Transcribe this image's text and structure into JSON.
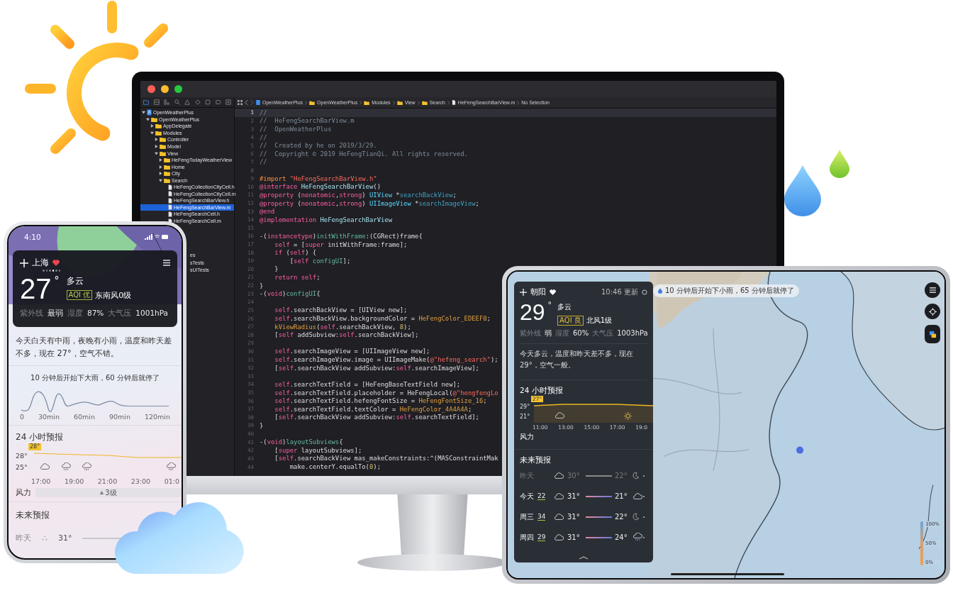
{
  "xcode": {
    "navigator_tabs": [
      {
        "kind": "folder",
        "selected": true
      },
      {
        "kind": "source",
        "selected": false
      },
      {
        "kind": "symbols",
        "selected": false
      },
      {
        "kind": "search",
        "selected": false
      },
      {
        "kind": "warning",
        "selected": false
      },
      {
        "kind": "test",
        "selected": false
      },
      {
        "kind": "debug",
        "selected": false
      },
      {
        "kind": "breakpoint",
        "selected": false
      },
      {
        "kind": "report",
        "selected": false
      }
    ],
    "tree": [
      {
        "label": "OpenWeatherPlus",
        "kind": "project",
        "expanded": true,
        "selected": false,
        "children": [
          {
            "label": "OpenWeatherPlus",
            "kind": "folder",
            "expanded": true,
            "selected": false,
            "children": [
              {
                "label": "AppDelegate",
                "kind": "folder",
                "expanded": false,
                "selected": false
              },
              {
                "label": "Modules",
                "kind": "folder",
                "expanded": true,
                "selected": false,
                "children": [
                  {
                    "label": "Controller",
                    "kind": "folder",
                    "expanded": false,
                    "selected": false
                  },
                  {
                    "label": "Model",
                    "kind": "folder",
                    "expanded": false,
                    "selected": false
                  },
                  {
                    "label": "View",
                    "kind": "folder",
                    "expanded": true,
                    "selected": false,
                    "children": [
                      {
                        "label": "HeFengTodayWeatherView",
                        "kind": "folder",
                        "expanded": false,
                        "selected": false
                      },
                      {
                        "label": "Home",
                        "kind": "folder",
                        "expanded": false,
                        "selected": false
                      },
                      {
                        "label": "City",
                        "kind": "folder",
                        "expanded": false,
                        "selected": false
                      },
                      {
                        "label": "Search",
                        "kind": "folder",
                        "expanded": true,
                        "selected": false,
                        "children": [
                          {
                            "label": "HeFengCollectionCityCell.h",
                            "kind": "file",
                            "selected": false
                          },
                          {
                            "label": "HeFengCollectionCityCell.m",
                            "kind": "file",
                            "selected": false
                          },
                          {
                            "label": "HeFengSearchBarView.h",
                            "kind": "file",
                            "selected": false
                          },
                          {
                            "label": "HeFengSearchBarView.m",
                            "kind": "file",
                            "selected": true
                          },
                          {
                            "label": "HeFengSearchCell.h",
                            "kind": "file",
                            "selected": false
                          },
                          {
                            "label": "HeFengSearchCell.m",
                            "kind": "file",
                            "selected": false
                          }
                        ]
                      }
                    ]
                  }
                ]
              }
            ]
          }
        ]
      }
    ],
    "tree_overflow": [
      "es",
      "sTests",
      "sUITests"
    ],
    "jump_bar": [
      {
        "kind": "project",
        "label": "OpenWeatherPlus"
      },
      {
        "kind": "folder",
        "label": "OpenWeatherPlus"
      },
      {
        "kind": "folder",
        "label": "Modules"
      },
      {
        "kind": "folder",
        "label": "View"
      },
      {
        "kind": "folder",
        "label": "Search"
      },
      {
        "kind": "file",
        "label": "HeFengSearchBarView.m"
      },
      {
        "kind": "none",
        "label": "No Selection"
      }
    ],
    "lines": [
      {
        "number": "1",
        "current": true,
        "tokens": [
          {
            "kind": "comment",
            "text": "//"
          }
        ]
      },
      {
        "number": "2",
        "current": false,
        "tokens": [
          {
            "kind": "comment",
            "text": "//  HeFengSearchBarView.m"
          }
        ]
      },
      {
        "number": "3",
        "current": false,
        "tokens": [
          {
            "kind": "comment",
            "text": "//  OpenWeatherPlus"
          }
        ]
      },
      {
        "number": "4",
        "current": false,
        "tokens": [
          {
            "kind": "comment",
            "text": "//"
          }
        ]
      },
      {
        "number": "5",
        "current": false,
        "tokens": [
          {
            "kind": "comment",
            "text": "//  Created by he on 2019/3/29."
          }
        ]
      },
      {
        "number": "6",
        "current": false,
        "tokens": [
          {
            "kind": "comment",
            "text": "//  Copyright © 2019 HeFengTianQi. All rights reserved."
          }
        ]
      },
      {
        "number": "7",
        "current": false,
        "tokens": [
          {
            "kind": "comment",
            "text": "//"
          }
        ]
      },
      {
        "number": "8",
        "current": false
      },
      {
        "number": "9",
        "current": false,
        "tokens": [
          {
            "kind": "preproc",
            "text": "#import "
          },
          {
            "kind": "string",
            "text": "\"HeFengSearchBarView.h\""
          }
        ]
      },
      {
        "number": "10",
        "current": false,
        "tokens": [
          {
            "kind": "keyword",
            "text": "@interface "
          },
          {
            "kind": "class",
            "text": "HeFengSearchBarView"
          },
          {
            "kind": "plain",
            "text": "()"
          }
        ]
      },
      {
        "number": "11",
        "current": false,
        "tokens": [
          {
            "kind": "keyword",
            "text": "@property"
          },
          {
            "kind": "plain",
            "text": " ("
          },
          {
            "kind": "keyword",
            "text": "nonatomic"
          },
          {
            "kind": "plain",
            "text": ","
          },
          {
            "kind": "keyword",
            "text": "strong"
          },
          {
            "kind": "plain",
            "text": ") "
          },
          {
            "kind": "type",
            "text": "UIView"
          },
          {
            "kind": "plain",
            "text": " *"
          },
          {
            "kind": "member",
            "text": "searchBackView"
          },
          {
            "kind": "plain",
            "text": ";"
          }
        ]
      },
      {
        "number": "12",
        "current": false,
        "tokens": [
          {
            "kind": "keyword",
            "text": "@property"
          },
          {
            "kind": "plain",
            "text": " ("
          },
          {
            "kind": "keyword",
            "text": "nonatomic"
          },
          {
            "kind": "plain",
            "text": ","
          },
          {
            "kind": "keyword",
            "text": "strong"
          },
          {
            "kind": "plain",
            "text": ") "
          },
          {
            "kind": "type",
            "text": "UIImageView"
          },
          {
            "kind": "plain",
            "text": " *"
          },
          {
            "kind": "member",
            "text": "searchImageView"
          },
          {
            "kind": "plain",
            "text": ";"
          }
        ]
      },
      {
        "number": "13",
        "current": false,
        "tokens": [
          {
            "kind": "keyword",
            "text": "@end"
          }
        ]
      },
      {
        "number": "14",
        "current": false,
        "tokens": [
          {
            "kind": "keyword",
            "text": "@implementation "
          },
          {
            "kind": "class",
            "text": "HeFengSearchBarView"
          }
        ]
      },
      {
        "number": "15",
        "current": false
      },
      {
        "number": "16",
        "current": false,
        "tokens": [
          {
            "kind": "plain",
            "text": "-("
          },
          {
            "kind": "keyword",
            "text": "instancetype"
          },
          {
            "kind": "plain",
            "text": ")"
          },
          {
            "kind": "method",
            "text": "initWithFrame"
          },
          {
            "kind": "plain",
            "text": ":(CGRect)frame{"
          }
        ]
      },
      {
        "number": "17",
        "current": false,
        "tokens": [
          {
            "kind": "keyword",
            "text": "    self"
          },
          {
            "kind": "plain",
            "text": " = ["
          },
          {
            "kind": "keyword",
            "text": "super"
          },
          {
            "kind": "plain",
            "text": " initWithFrame:frame];"
          }
        ]
      },
      {
        "number": "18",
        "current": false,
        "tokens": [
          {
            "kind": "keyword",
            "text": "    if"
          },
          {
            "kind": "plain",
            "text": " ("
          },
          {
            "kind": "keyword",
            "text": "self"
          },
          {
            "kind": "plain",
            "text": ") {"
          }
        ]
      },
      {
        "number": "19",
        "current": false,
        "tokens": [
          {
            "kind": "plain",
            "text": "        ["
          },
          {
            "kind": "keyword",
            "text": "self"
          },
          {
            "kind": "method",
            "text": " configUI"
          },
          {
            "kind": "plain",
            "text": "];"
          }
        ]
      },
      {
        "number": "20",
        "current": false,
        "tokens": [
          {
            "kind": "plain",
            "text": "    }"
          }
        ]
      },
      {
        "number": "21",
        "current": false,
        "tokens": [
          {
            "kind": "keyword",
            "text": "    return self"
          },
          {
            "kind": "plain",
            "text": ";"
          }
        ]
      },
      {
        "number": "22",
        "current": false,
        "tokens": [
          {
            "kind": "plain",
            "text": "}"
          }
        ]
      },
      {
        "number": "23",
        "current": false,
        "tokens": [
          {
            "kind": "plain",
            "text": "-("
          },
          {
            "kind": "keyword",
            "text": "void"
          },
          {
            "kind": "plain",
            "text": ")"
          },
          {
            "kind": "method",
            "text": "configUI"
          },
          {
            "kind": "plain",
            "text": "{"
          }
        ]
      },
      {
        "number": "24",
        "current": false
      },
      {
        "number": "25",
        "current": false,
        "tokens": [
          {
            "kind": "keyword",
            "text": "    self"
          },
          {
            "kind": "plain",
            "text": ".searchBackView = [UIView new];"
          }
        ]
      },
      {
        "number": "26",
        "current": false,
        "tokens": [
          {
            "kind": "keyword",
            "text": "    self"
          },
          {
            "kind": "plain",
            "text": ".searchBackView.backgroundColor = "
          },
          {
            "kind": "macro",
            "text": "HeFengColor_EDEEF0"
          },
          {
            "kind": "plain",
            "text": ";"
          }
        ]
      },
      {
        "number": "27",
        "current": false,
        "tokens": [
          {
            "kind": "macro",
            "text": "    kViewRadius"
          },
          {
            "kind": "plain",
            "text": "("
          },
          {
            "kind": "keyword",
            "text": "self"
          },
          {
            "kind": "plain",
            "text": ".searchBackView, "
          },
          {
            "kind": "number",
            "text": "8"
          },
          {
            "kind": "plain",
            "text": ");"
          }
        ]
      },
      {
        "number": "28",
        "current": false,
        "tokens": [
          {
            "kind": "plain",
            "text": "    ["
          },
          {
            "kind": "keyword",
            "text": "self"
          },
          {
            "kind": "plain",
            "text": " addSubview:"
          },
          {
            "kind": "keyword",
            "text": "self"
          },
          {
            "kind": "plain",
            "text": ".searchBackView];"
          }
        ]
      },
      {
        "number": "29",
        "current": false
      },
      {
        "number": "30",
        "current": false,
        "tokens": [
          {
            "kind": "keyword",
            "text": "    self"
          },
          {
            "kind": "plain",
            "text": ".searchImageView = [UIImageView new];"
          }
        ]
      },
      {
        "number": "31",
        "current": false,
        "tokens": [
          {
            "kind": "keyword",
            "text": "    self"
          },
          {
            "kind": "plain",
            "text": ".searchImageView.image = UIImageMake("
          },
          {
            "kind": "string",
            "text": "@\"hefeng_search\""
          },
          {
            "kind": "plain",
            "text": ");"
          }
        ]
      },
      {
        "number": "32",
        "current": false,
        "tokens": [
          {
            "kind": "plain",
            "text": "    ["
          },
          {
            "kind": "keyword",
            "text": "self"
          },
          {
            "kind": "plain",
            "text": ".searchBackView addSubview:"
          },
          {
            "kind": "keyword",
            "text": "self"
          },
          {
            "kind": "plain",
            "text": ".searchImageView];"
          }
        ]
      },
      {
        "number": "33",
        "current": false
      },
      {
        "number": "34",
        "current": false,
        "tokens": [
          {
            "kind": "keyword",
            "text": "    self"
          },
          {
            "kind": "plain",
            "text": ".searchTextField = [HeFengBaseTextField new];"
          }
        ]
      },
      {
        "number": "35",
        "current": false,
        "tokens": [
          {
            "kind": "keyword",
            "text": "    self"
          },
          {
            "kind": "plain",
            "text": ".searchTextField.placeholder = HeFengLocal("
          },
          {
            "kind": "string",
            "text": "@\"hengfengLo"
          }
        ]
      },
      {
        "number": "36",
        "current": false,
        "tokens": [
          {
            "kind": "keyword",
            "text": "    self"
          },
          {
            "kind": "plain",
            "text": ".searchTextField.hefengFontSize = "
          },
          {
            "kind": "macro",
            "text": "HeFengFontSize_16"
          },
          {
            "kind": "plain",
            "text": ";"
          }
        ]
      },
      {
        "number": "37",
        "current": false,
        "tokens": [
          {
            "kind": "keyword",
            "text": "    self"
          },
          {
            "kind": "plain",
            "text": ".searchTextField.textColor = "
          },
          {
            "kind": "macro",
            "text": "HeFengColor_4A4A4A"
          },
          {
            "kind": "plain",
            "text": ";"
          }
        ]
      },
      {
        "number": "38",
        "current": false,
        "tokens": [
          {
            "kind": "plain",
            "text": "    ["
          },
          {
            "kind": "keyword",
            "text": "self"
          },
          {
            "kind": "plain",
            "text": ".searchBackView addSubview:"
          },
          {
            "kind": "keyword",
            "text": "self"
          },
          {
            "kind": "plain",
            "text": ".searchTextField];"
          }
        ]
      },
      {
        "number": "39",
        "current": false,
        "tokens": [
          {
            "kind": "plain",
            "text": "}"
          }
        ]
      },
      {
        "number": "40",
        "current": false
      },
      {
        "number": "41",
        "current": false,
        "tokens": [
          {
            "kind": "plain",
            "text": "-("
          },
          {
            "kind": "keyword",
            "text": "void"
          },
          {
            "kind": "plain",
            "text": ")"
          },
          {
            "kind": "method",
            "text": "layoutSubviews"
          },
          {
            "kind": "plain",
            "text": "{"
          }
        ]
      },
      {
        "number": "42",
        "current": false,
        "tokens": [
          {
            "kind": "plain",
            "text": "    ["
          },
          {
            "kind": "keyword",
            "text": "super"
          },
          {
            "kind": "plain",
            "text": " layoutSubviews];"
          }
        ]
      },
      {
        "number": "43",
        "current": false,
        "tokens": [
          {
            "kind": "plain",
            "text": "    ["
          },
          {
            "kind": "keyword",
            "text": "self"
          },
          {
            "kind": "plain",
            "text": ".searchBackView mas_makeConstraints:^(MASConstraintMak"
          }
        ]
      },
      {
        "number": "44",
        "current": false,
        "tokens": [
          {
            "kind": "plain",
            "text": "        make.centerY.equalTo("
          },
          {
            "kind": "number",
            "text": "0"
          },
          {
            "kind": "plain",
            "text": ");"
          }
        ]
      }
    ]
  },
  "phone": {
    "status_time": "4:10",
    "city": "上海",
    "favorite": true,
    "pages": [
      {
        "selected": false
      },
      {
        "selected": false
      },
      {
        "selected": false
      },
      {
        "selected": true
      },
      {
        "selected": false
      },
      {
        "selected": false
      }
    ],
    "temperature": "27",
    "unit": "°",
    "condition": "多云",
    "aqi": "AQI 优",
    "wind": "东南风0级",
    "stats": [
      {
        "label": "紫外线",
        "value": "最弱"
      },
      {
        "label": "湿度",
        "value": "87%"
      },
      {
        "label": "大气压",
        "value": "1001hPa"
      }
    ],
    "summary": "今天白天有中雨，夜晚有小雨，温度和昨天差不多，现在 27°，空气不错。",
    "rain_note": "10 分钟后开始下大雨，60 分钟后就停了",
    "rain_axis": [
      "0",
      "30min",
      "60min",
      "90min",
      "120min"
    ],
    "hourly_title": "24 小时预报",
    "hourly_badge": "28°",
    "hourly_high": "28°",
    "hourly_low": "25°",
    "hourly_times": [
      "17:00",
      "19:00",
      "21:00",
      "23:00",
      "01:0"
    ],
    "wind_label": "风力",
    "wind_level": "3级",
    "forecast_title": "未来预报",
    "forecast": [
      {
        "day": "昨天",
        "high": "31°"
      }
    ]
  },
  "tablet": {
    "panel": {
      "city": "朝阳",
      "favorite": true,
      "updated": "10:46 更新",
      "temperature": "29",
      "unit": "°",
      "condition": "多云",
      "aqi": "AQI 良",
      "wind": "北风1级",
      "stats": [
        {
          "label": "紫外线",
          "value": "弱"
        },
        {
          "label": "湿度",
          "value": "60%"
        },
        {
          "label": "大气压",
          "value": "1003hPa"
        }
      ],
      "summary": "今天多云，温度和昨天差不多，现在 29°，空气一般。",
      "hourly_title": "24 小时预报",
      "hourly_badge": "27°",
      "hourly_high": "29°",
      "hourly_low": "21°",
      "hourly_times": [
        "11:00",
        "13:00",
        "15:00",
        "17:00",
        "19:0"
      ],
      "wind_label": "风力",
      "forecast_title": "未来预报",
      "daily": [
        {
          "day": "昨天",
          "past": true,
          "high": "30°",
          "low": "22°"
        },
        {
          "day": "今天",
          "past": false,
          "aqi": "22",
          "high": "31°",
          "low": "21°"
        },
        {
          "day": "周三",
          "past": false,
          "aqi": "34",
          "high": "31°",
          "low": "22°"
        },
        {
          "day": "周四",
          "past": false,
          "aqi": "29",
          "high": "31°",
          "low": "24°"
        }
      ]
    },
    "map": {
      "notice": "10 分钟后开始下小雨，65 分钟后就停了",
      "buttons": [
        {
          "kind": "menu"
        },
        {
          "kind": "locate"
        },
        {
          "kind": "layers"
        }
      ],
      "legend": [
        "100%",
        "50%",
        "0%"
      ]
    }
  }
}
